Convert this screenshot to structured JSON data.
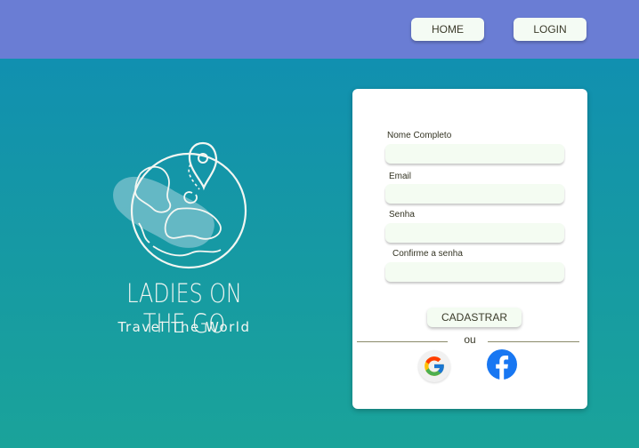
{
  "header": {
    "home_label": "HOME",
    "login_label": "LOGIN"
  },
  "logo": {
    "title": "LADIES ON THE GO",
    "subtitle": "Travel The World"
  },
  "form": {
    "fields": [
      {
        "label": "Nome Completo",
        "value": ""
      },
      {
        "label": "Email",
        "value": ""
      },
      {
        "label": "Senha",
        "value": ""
      },
      {
        "label": "Confirme a senha",
        "value": ""
      }
    ],
    "submit_label": "CADASTRAR",
    "divider_text": "ou"
  },
  "social": {
    "google_icon": "google-icon",
    "facebook_icon": "facebook-icon"
  },
  "colors": {
    "topbar": "#6a7dd4",
    "background_top": "#0f8db4",
    "background_bottom": "#1aa39a",
    "input_bg": "#f4fcf2",
    "facebook_blue": "#1877f2"
  }
}
